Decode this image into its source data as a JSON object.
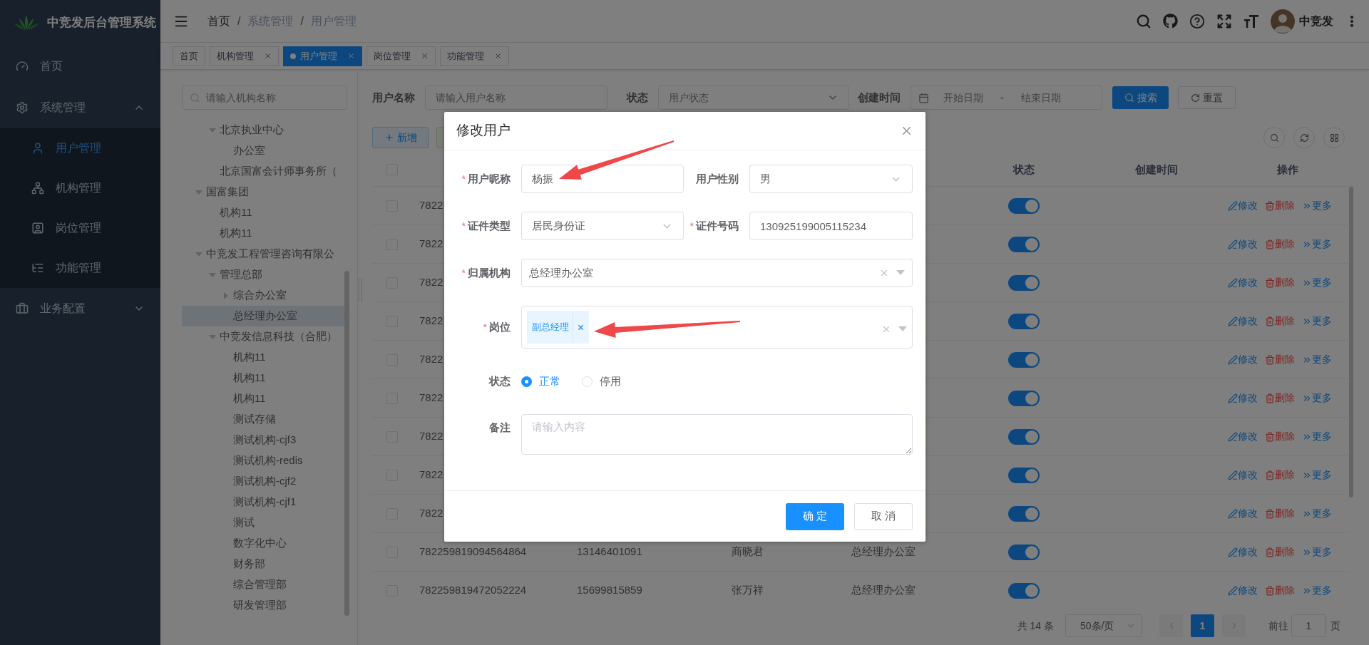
{
  "sidebar": {
    "title": "中竞发后台管理系统",
    "items": [
      {
        "label": "首页",
        "selected": false
      },
      {
        "label": "系统管理",
        "expanded": true,
        "children": [
          {
            "label": "用户管理",
            "selected": true
          },
          {
            "label": "机构管理",
            "selected": false
          },
          {
            "label": "岗位管理",
            "selected": false
          },
          {
            "label": "功能管理",
            "selected": false
          }
        ]
      },
      {
        "label": "业务配置",
        "expanded": false
      }
    ]
  },
  "navbar": {
    "breadcrumb": [
      {
        "label": "首页"
      },
      {
        "label": "系统管理"
      },
      {
        "label": "用户管理"
      }
    ],
    "separator": "/",
    "user_name": "中竞发"
  },
  "tags": [
    {
      "label": "首页",
      "selected": false,
      "closable": false
    },
    {
      "label": "机构管理",
      "selected": false,
      "closable": true
    },
    {
      "label": "用户管理",
      "selected": true,
      "closable": true
    },
    {
      "label": "岗位管理",
      "selected": false,
      "closable": true
    },
    {
      "label": "功能管理",
      "selected": false,
      "closable": true
    }
  ],
  "org_tree": {
    "search_placeholder": "请输入机构名称",
    "scrolled_branch": [
      {
        "label": "北京执业中心",
        "expanded": true,
        "selected": false,
        "children": [
          {
            "label": "办公室",
            "selected": false
          }
        ]
      },
      {
        "label": "北京国富会计师事务所（",
        "selected": false
      }
    ],
    "nodes": [
      {
        "label": "国富集团",
        "expanded": true,
        "selected": false,
        "children": [
          {
            "label": "机构11",
            "selected": false
          },
          {
            "label": "机构11",
            "selected": false
          }
        ]
      },
      {
        "label": "中竞发工程管理咨询有限公",
        "expanded": true,
        "selected": false,
        "children": [
          {
            "label": "管理总部",
            "expanded": true,
            "selected": false,
            "children": [
              {
                "label": "综合办公室",
                "expanded": false,
                "selected": false
              },
              {
                "label": "总经理办公室",
                "selected": true
              }
            ]
          },
          {
            "label": "中竞发信息科技（合肥）",
            "expanded": true,
            "selected": false,
            "children": [
              {
                "label": "机构11",
                "selected": false
              },
              {
                "label": "机构11",
                "selected": false
              },
              {
                "label": "机构11",
                "selected": false
              },
              {
                "label": "测试存储",
                "selected": false
              },
              {
                "label": "测试机构-cjf3",
                "selected": false
              },
              {
                "label": "测试机构-redis",
                "selected": false
              },
              {
                "label": "测试机构-cjf2",
                "selected": false
              },
              {
                "label": "测试机构-cjf1",
                "selected": false
              },
              {
                "label": "测试",
                "selected": false
              },
              {
                "label": "数字化中心",
                "selected": false
              },
              {
                "label": "财务部",
                "selected": false
              },
              {
                "label": "综合管理部",
                "selected": false
              },
              {
                "label": "研发管理部",
                "selected": false
              }
            ]
          }
        ]
      }
    ]
  },
  "filters": {
    "user_name": {
      "label": "用户名称",
      "placeholder": "请输入用户名称"
    },
    "status": {
      "label": "状态",
      "placeholder": "用户状态"
    },
    "created": {
      "label": "创建时间",
      "start_placeholder": "开始日期",
      "separator": "-",
      "end_placeholder": "结束日期"
    },
    "search_button": "搜索",
    "reset_button": "重置"
  },
  "toolbar": {
    "add_button": "新增"
  },
  "table": {
    "columns": [
      "状态",
      "创建时间",
      "操作"
    ],
    "header_checked": false,
    "rows": [
      {
        "checked": false,
        "id": "7822",
        "on": true,
        "actions": [
          {
            "kind": "edit",
            "label": "修改"
          },
          {
            "kind": "delete",
            "label": "删除"
          },
          {
            "kind": "more",
            "label": "更多"
          }
        ]
      },
      {
        "checked": false,
        "id": "7822",
        "on": true,
        "actions": [
          {
            "kind": "edit",
            "label": "修改"
          },
          {
            "kind": "delete",
            "label": "删除"
          },
          {
            "kind": "more",
            "label": "更多"
          }
        ]
      },
      {
        "checked": false,
        "id": "7822",
        "on": true,
        "actions": [
          {
            "kind": "edit",
            "label": "修改"
          },
          {
            "kind": "delete",
            "label": "删除"
          },
          {
            "kind": "more",
            "label": "更多"
          }
        ]
      },
      {
        "checked": false,
        "id": "7822",
        "on": true,
        "actions": [
          {
            "kind": "edit",
            "label": "修改"
          },
          {
            "kind": "delete",
            "label": "删除"
          },
          {
            "kind": "more",
            "label": "更多"
          }
        ]
      },
      {
        "checked": false,
        "id": "7822",
        "on": true,
        "actions": [
          {
            "kind": "edit",
            "label": "修改"
          },
          {
            "kind": "delete",
            "label": "删除"
          },
          {
            "kind": "more",
            "label": "更多"
          }
        ]
      },
      {
        "checked": false,
        "id": "7822",
        "on": true,
        "actions": [
          {
            "kind": "edit",
            "label": "修改"
          },
          {
            "kind": "delete",
            "label": "删除"
          },
          {
            "kind": "more",
            "label": "更多"
          }
        ]
      },
      {
        "checked": false,
        "id": "7822",
        "on": true,
        "actions": [
          {
            "kind": "edit",
            "label": "修改"
          },
          {
            "kind": "delete",
            "label": "删除"
          },
          {
            "kind": "more",
            "label": "更多"
          }
        ]
      },
      {
        "checked": false,
        "id": "7822",
        "on": true,
        "actions": [
          {
            "kind": "edit",
            "label": "修改"
          },
          {
            "kind": "delete",
            "label": "删除"
          },
          {
            "kind": "more",
            "label": "更多"
          }
        ]
      },
      {
        "checked": false,
        "id": "7822",
        "on": true,
        "actions": [
          {
            "kind": "edit",
            "label": "修改"
          },
          {
            "kind": "delete",
            "label": "删除"
          },
          {
            "kind": "more",
            "label": "更多"
          }
        ]
      },
      {
        "checked": false,
        "id": "782259819094564864",
        "phone": "13146401091",
        "name": "商晓君",
        "org": "总经理办公室",
        "on": true,
        "actions": [
          {
            "kind": "edit",
            "label": "修改"
          },
          {
            "kind": "delete",
            "label": "删除"
          },
          {
            "kind": "more",
            "label": "更多"
          }
        ]
      },
      {
        "checked": false,
        "id": "782259819472052224",
        "phone": "15699815859",
        "name": "张万祥",
        "org": "总经理办公室",
        "on": true,
        "actions": [
          {
            "kind": "edit",
            "label": "修改"
          },
          {
            "kind": "delete",
            "label": "删除"
          },
          {
            "kind": "more",
            "label": "更多"
          }
        ]
      }
    ]
  },
  "pagination": {
    "total": "共 14 条",
    "page_size": "50条/页",
    "pages": [
      {
        "label": "1",
        "selected": true
      }
    ],
    "jump_label": "前往",
    "jump_value": "1",
    "page_suffix": "页"
  },
  "dialog": {
    "title": "修改用户",
    "required_mark": "*",
    "rows": [
      [
        {
          "kind": "input",
          "label": "用户昵称",
          "required": true,
          "value": "杨振"
        },
        {
          "kind": "select",
          "label": "用户性别",
          "required": false,
          "value": "男"
        }
      ],
      [
        {
          "kind": "select",
          "label": "证件类型",
          "required": true,
          "value": "居民身份证"
        },
        {
          "kind": "input",
          "label": "证件号码",
          "required": true,
          "value": "130925199005115234"
        }
      ],
      [
        {
          "kind": "tree_select",
          "label": "归属机构",
          "required": true,
          "value": "总经理办公室"
        }
      ],
      [
        {
          "kind": "tag_select",
          "label": "岗位",
          "required": true,
          "tags": [
            "副总经理"
          ]
        }
      ],
      [
        {
          "kind": "radio",
          "label": "状态",
          "required": false,
          "options": [
            {
              "label": "正常",
              "selected": true
            },
            {
              "label": "停用",
              "selected": false
            }
          ]
        }
      ],
      [
        {
          "kind": "textarea",
          "label": "备注",
          "required": false,
          "placeholder": "请输入内容"
        }
      ]
    ],
    "buttons": [
      {
        "kind": "primary",
        "label": "确 定"
      },
      {
        "kind": "default",
        "label": "取 消"
      }
    ]
  }
}
